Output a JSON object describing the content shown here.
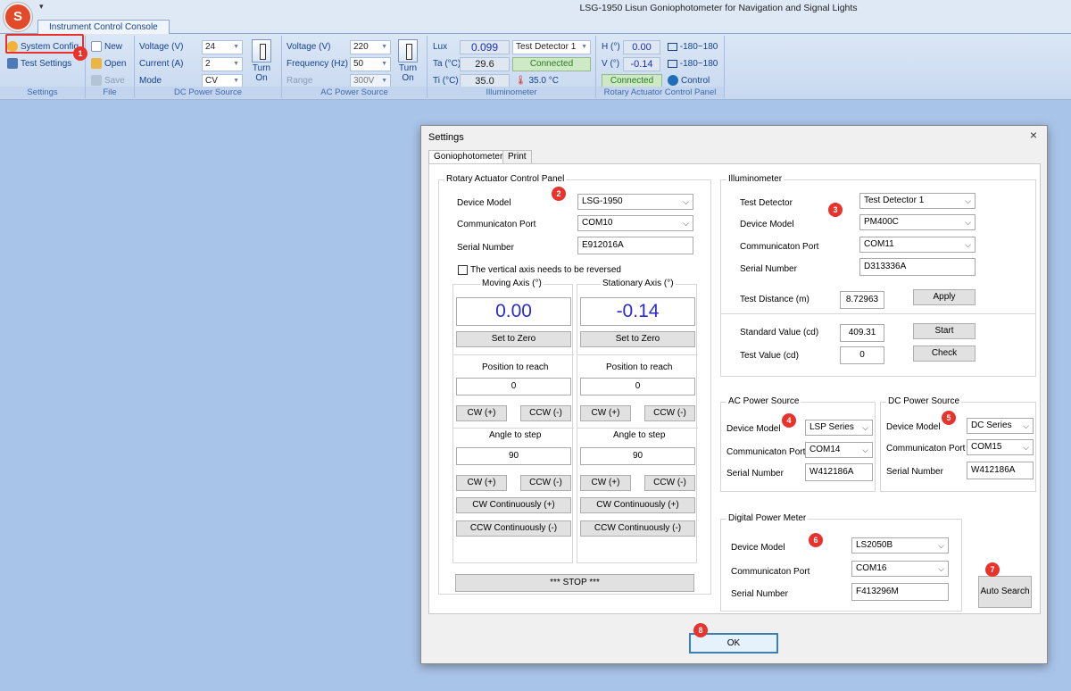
{
  "window": {
    "title": "LSG-1950 Lisun Goniophotometer for Navigation and Signal Lights",
    "logo_text": "S"
  },
  "ribbon": {
    "tab": "Instrument Control Console",
    "settings": {
      "system_config": "System Config",
      "test_settings": "Test Settings",
      "group": "Settings"
    },
    "file": {
      "new": "New",
      "open": "Open",
      "save": "Save",
      "group": "File"
    },
    "dc": {
      "voltage_label": "Voltage (V)",
      "voltage": "24",
      "current_label": "Current (A)",
      "current": "2",
      "mode_label": "Mode",
      "mode": "CV",
      "turn_on": "Turn",
      "turn_on2": "On",
      "group": "DC Power Source"
    },
    "ac": {
      "voltage_label": "Voltage (V)",
      "voltage": "220",
      "freq_label": "Frequency (Hz)",
      "freq": "50",
      "range_label": "Range",
      "range": "300V",
      "turn_on": "Turn",
      "turn_on2": "On",
      "group": "AC Power Source"
    },
    "illum": {
      "lux_label": "Lux",
      "lux": "0.099",
      "ta_label": "Ta (°C)",
      "ta": "29.6",
      "ti_label": "Ti (°C)",
      "ti": "35.0",
      "detector": "Test Detector 1",
      "status": "Connected",
      "temp": "35.0 °C",
      "group": "Illuminometer"
    },
    "rotary": {
      "h_label": "H (°)",
      "h": "0.00",
      "v_label": "V (°)",
      "v": "-0.14",
      "h_range": "-180~180",
      "v_range": "-180~180",
      "status": "Connected",
      "control": "Control",
      "group": "Rotary Actuator Control Panel"
    }
  },
  "dialog": {
    "title": "Settings",
    "close": "×",
    "tabs": [
      "Goniophotometer",
      "Print"
    ],
    "rotary": {
      "legend": "Rotary Actuator Control Panel",
      "device_model_label": "Device Model",
      "device_model": "LSG-1950",
      "port_label": "Communicaton Port",
      "port": "COM10",
      "serial_label": "Serial Number",
      "serial": "E912016A",
      "reverse_label": "The vertical axis needs to be reversed",
      "moving": {
        "title": "Moving Axis (°)",
        "value": "0.00",
        "zero": "Set to Zero",
        "pos_label": "Position to reach",
        "pos": "0",
        "cw": "CW  (+)",
        "ccw": "CCW  (-)",
        "step_label": "Angle to step",
        "step": "90",
        "cw2": "CW  (+)",
        "ccw2": "CCW  (-)",
        "cw_cont": "CW Continuously (+)",
        "ccw_cont": "CCW Continuously (-)"
      },
      "stationary": {
        "title": "Stationary Axis (°)",
        "value": "-0.14",
        "zero": "Set to Zero",
        "pos_label": "Position to reach",
        "pos": "0",
        "cw": "CW  (+)",
        "ccw": "CCW  (-)",
        "step_label": "Angle to step",
        "step": "90",
        "cw2": "CW  (+)",
        "ccw2": "CCW  (-)",
        "cw_cont": "CW Continuously (+)",
        "ccw_cont": "CCW Continuously (-)"
      },
      "stop": "*** STOP ***"
    },
    "illuminometer": {
      "legend": "Illuminometer",
      "detector_label": "Test Detector",
      "detector": "Test Detector 1",
      "device_model_label": "Device Model",
      "device_model": "PM400C",
      "port_label": "Communicaton Port",
      "port": "COM11",
      "serial_label": "Serial Number",
      "serial": "D313336A",
      "distance_label": "Test Distance (m)",
      "distance": "8.72963",
      "apply": "Apply",
      "standard_label": "Standard Value (cd)",
      "standard": "409.31",
      "start": "Start",
      "test_label": "Test Value (cd)",
      "test": "0",
      "check": "Check"
    },
    "ac": {
      "legend": "AC Power Source",
      "device_model_label": "Device Model",
      "device_model": "LSP Series",
      "port_label": "Communicaton Port",
      "port": "COM14",
      "serial_label": "Serial Number",
      "serial": "W412186A"
    },
    "dc": {
      "legend": "DC Power Source",
      "device_model_label": "Device Model",
      "device_model": "DC Series",
      "port_label": "Communicaton Port",
      "port": "COM15",
      "serial_label": "Serial Number",
      "serial": "W412186A"
    },
    "meter": {
      "legend": "Digital Power Meter",
      "device_model_label": "Device Model",
      "device_model": "LS2050B",
      "port_label": "Communicaton Port",
      "port": "COM16",
      "serial_label": "Serial Number",
      "serial": "F413296M"
    },
    "auto_search": "Auto Search",
    "ok": "OK"
  },
  "markers": [
    "1",
    "2",
    "3",
    "4",
    "5",
    "6",
    "7",
    "8"
  ],
  "colors": {
    "marker": "#e8322c",
    "accent_blue": "#2b2bd0",
    "connected_green": "#2c7a23"
  }
}
